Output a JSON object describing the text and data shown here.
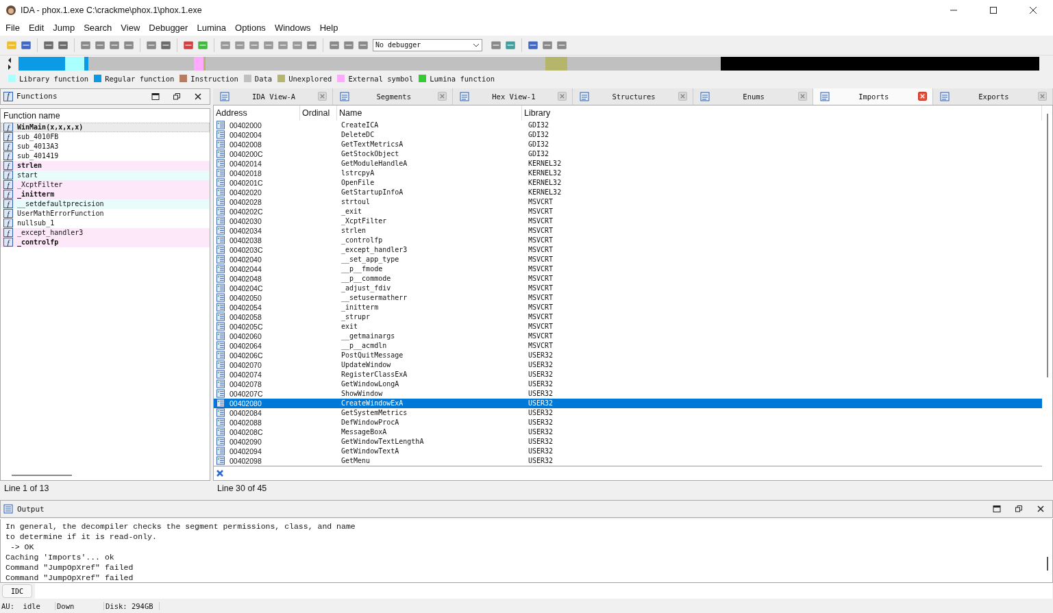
{
  "window": {
    "title": "IDA - phox.1.exe C:\\crackme\\phox.1\\phox.1.exe"
  },
  "menu": [
    "File",
    "Edit",
    "Jump",
    "Search",
    "View",
    "Debugger",
    "Lumina",
    "Options",
    "Windows",
    "Help"
  ],
  "debugger_select": {
    "value": "No debugger"
  },
  "legend": [
    {
      "label": "Library function",
      "color": "#aaffff"
    },
    {
      "label": "Regular function",
      "color": "#0a9ae6"
    },
    {
      "label": "Instruction",
      "color": "#b87c5c"
    },
    {
      "label": "Data",
      "color": "#c0c0c0"
    },
    {
      "label": "Unexplored",
      "color": "#b5b56c"
    },
    {
      "label": "External symbol",
      "color": "#ffaaff"
    },
    {
      "label": "Lumina function",
      "color": "#33cc33"
    }
  ],
  "functions_panel": {
    "icon": "f",
    "title": "Functions",
    "column": "Function name",
    "status": "Line 1 of 13",
    "items": [
      {
        "icon": "f",
        "name": "WinMain(x,x,x,x)",
        "bold": true,
        "selected": true,
        "color": "#ebebeb"
      },
      {
        "icon": "f",
        "name": "sub_4010FB",
        "bold": false,
        "selected": false,
        "color": "#ffffff"
      },
      {
        "icon": "f",
        "name": "sub_4013A3",
        "bold": false,
        "selected": false,
        "color": "#ffffff"
      },
      {
        "icon": "f",
        "name": "sub_401419",
        "bold": false,
        "selected": false,
        "color": "#ffffff"
      },
      {
        "icon": "f",
        "name": "strlen",
        "bold": true,
        "selected": false,
        "color": "#fde8fa"
      },
      {
        "icon": "f",
        "name": "start",
        "bold": false,
        "selected": false,
        "color": "#e8fcfc"
      },
      {
        "icon": "f",
        "name": "_XcptFilter",
        "bold": false,
        "selected": false,
        "color": "#fde8fa"
      },
      {
        "icon": "f",
        "name": "_initterm",
        "bold": true,
        "selected": false,
        "color": "#fde8fa"
      },
      {
        "icon": "f",
        "name": "__setdefaultprecision",
        "bold": false,
        "selected": false,
        "color": "#e8fcfc"
      },
      {
        "icon": "f",
        "name": "UserMathErrorFunction",
        "bold": false,
        "selected": false,
        "color": "#ffffff"
      },
      {
        "icon": "f",
        "name": "nullsub_1",
        "bold": false,
        "selected": false,
        "color": "#ffffff"
      },
      {
        "icon": "f",
        "name": "_except_handler3",
        "bold": false,
        "selected": false,
        "color": "#fde8fa"
      },
      {
        "icon": "f",
        "name": "_controlfp",
        "bold": true,
        "selected": false,
        "color": "#fde8fa"
      }
    ]
  },
  "tabs": [
    {
      "label": "IDA View-A",
      "selected": false
    },
    {
      "label": "Segments",
      "selected": false
    },
    {
      "label": "Hex View-1",
      "selected": false
    },
    {
      "label": "Structures",
      "selected": false
    },
    {
      "label": "Enums",
      "selected": false
    },
    {
      "label": "Imports",
      "selected": true
    },
    {
      "label": "Exports",
      "selected": false
    }
  ],
  "imports": {
    "columns": [
      "Address",
      "Ordinal",
      "Name",
      "Library"
    ],
    "status": "Line 30 of 45",
    "rows": [
      {
        "address": "00402000",
        "name": "CreateICA",
        "library": "GDI32",
        "selected": false
      },
      {
        "address": "00402004",
        "name": "DeleteDC",
        "library": "GDI32",
        "selected": false
      },
      {
        "address": "00402008",
        "name": "GetTextMetricsA",
        "library": "GDI32",
        "selected": false
      },
      {
        "address": "0040200C",
        "name": "GetStockObject",
        "library": "GDI32",
        "selected": false
      },
      {
        "address": "00402014",
        "name": "GetModuleHandleA",
        "library": "KERNEL32",
        "selected": false
      },
      {
        "address": "00402018",
        "name": "lstrcpyA",
        "library": "KERNEL32",
        "selected": false
      },
      {
        "address": "0040201C",
        "name": "OpenFile",
        "library": "KERNEL32",
        "selected": false
      },
      {
        "address": "00402020",
        "name": "GetStartupInfoA",
        "library": "KERNEL32",
        "selected": false
      },
      {
        "address": "00402028",
        "name": "strtoul",
        "library": "MSVCRT",
        "selected": false
      },
      {
        "address": "0040202C",
        "name": "_exit",
        "library": "MSVCRT",
        "selected": false
      },
      {
        "address": "00402030",
        "name": "_XcptFilter",
        "library": "MSVCRT",
        "selected": false
      },
      {
        "address": "00402034",
        "name": "strlen",
        "library": "MSVCRT",
        "selected": false
      },
      {
        "address": "00402038",
        "name": "_controlfp",
        "library": "MSVCRT",
        "selected": false
      },
      {
        "address": "0040203C",
        "name": "_except_handler3",
        "library": "MSVCRT",
        "selected": false
      },
      {
        "address": "00402040",
        "name": "__set_app_type",
        "library": "MSVCRT",
        "selected": false
      },
      {
        "address": "00402044",
        "name": "__p__fmode",
        "library": "MSVCRT",
        "selected": false
      },
      {
        "address": "00402048",
        "name": "__p__commode",
        "library": "MSVCRT",
        "selected": false
      },
      {
        "address": "0040204C",
        "name": "_adjust_fdiv",
        "library": "MSVCRT",
        "selected": false
      },
      {
        "address": "00402050",
        "name": "__setusermatherr",
        "library": "MSVCRT",
        "selected": false
      },
      {
        "address": "00402054",
        "name": "_initterm",
        "library": "MSVCRT",
        "selected": false
      },
      {
        "address": "00402058",
        "name": "_strupr",
        "library": "MSVCRT",
        "selected": false
      },
      {
        "address": "0040205C",
        "name": "exit",
        "library": "MSVCRT",
        "selected": false
      },
      {
        "address": "00402060",
        "name": "__getmainargs",
        "library": "MSVCRT",
        "selected": false
      },
      {
        "address": "00402064",
        "name": "__p__acmdln",
        "library": "MSVCRT",
        "selected": false
      },
      {
        "address": "0040206C",
        "name": "PostQuitMessage",
        "library": "USER32",
        "selected": false
      },
      {
        "address": "00402070",
        "name": "UpdateWindow",
        "library": "USER32",
        "selected": false
      },
      {
        "address": "00402074",
        "name": "RegisterClassExA",
        "library": "USER32",
        "selected": false
      },
      {
        "address": "00402078",
        "name": "GetWindowLongA",
        "library": "USER32",
        "selected": false
      },
      {
        "address": "0040207C",
        "name": "ShowWindow",
        "library": "USER32",
        "selected": false
      },
      {
        "address": "00402080",
        "name": "CreateWindowExA",
        "library": "USER32",
        "selected": true
      },
      {
        "address": "00402084",
        "name": "GetSystemMetrics",
        "library": "USER32",
        "selected": false
      },
      {
        "address": "00402088",
        "name": "DefWindowProcA",
        "library": "USER32",
        "selected": false
      },
      {
        "address": "0040208C",
        "name": "MessageBoxA",
        "library": "USER32",
        "selected": false
      },
      {
        "address": "00402090",
        "name": "GetWindowTextLengthA",
        "library": "USER32",
        "selected": false
      },
      {
        "address": "00402094",
        "name": "GetWindowTextA",
        "library": "USER32",
        "selected": false
      },
      {
        "address": "00402098",
        "name": "GetMenu",
        "library": "USER32",
        "selected": false
      }
    ]
  },
  "output": {
    "title": "Output",
    "lines": [
      "In general, the decompiler checks the segment permissions, class, and name",
      "to determine if it is read-only.",
      " -> OK",
      "Caching 'Imports'... ok",
      "Command \"JumpOpXref\" failed",
      "Command \"JumpOpXref\" failed"
    ],
    "language_button": "IDC"
  },
  "status_bar": [
    "AU:  idle",
    "Down",
    "Disk: 294GB"
  ]
}
